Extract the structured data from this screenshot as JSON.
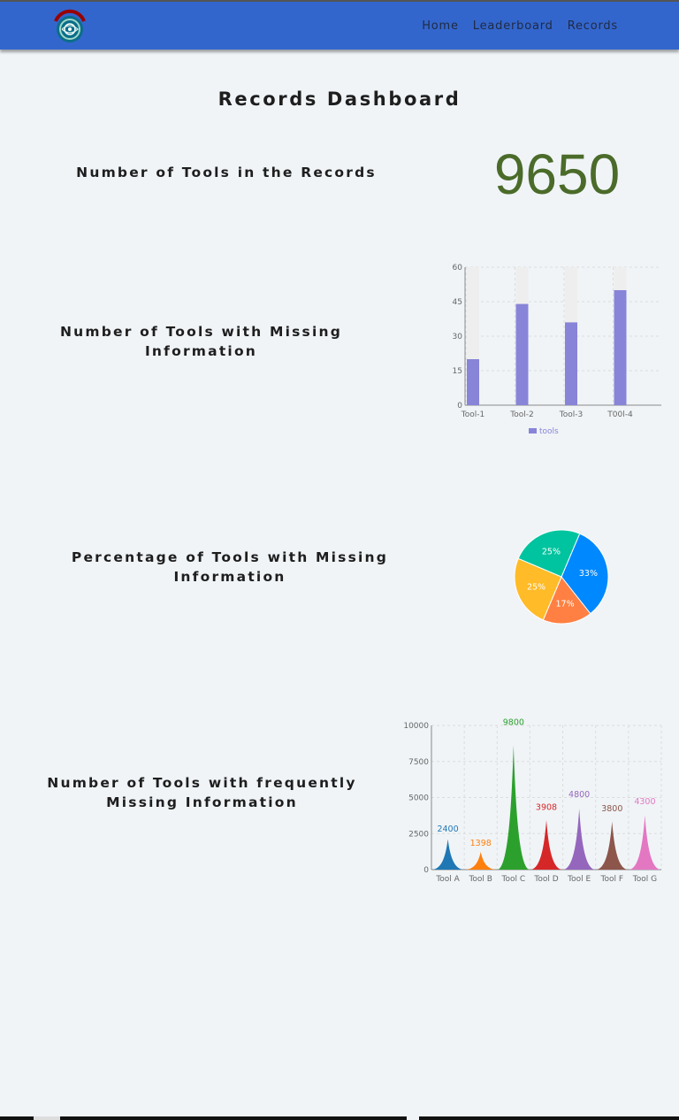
{
  "nav": {
    "links": [
      "Home",
      "Leaderboard",
      "Records"
    ]
  },
  "page": {
    "title": "Records Dashboard"
  },
  "sections": {
    "total": {
      "label": "Number of Tools in the Records",
      "value": "9650"
    },
    "missing": {
      "label_line1": "Number of Tools with Missing",
      "label_line2": "Information"
    },
    "percentage": {
      "label_line1": "Percentage of Tools with Missing",
      "label_line2": "Information"
    },
    "frequent": {
      "label_line1": "Number of Tools with frequently",
      "label_line2": "Missing Information"
    }
  },
  "colors": {
    "navbar": "#3366cc",
    "big_number": "#4b6b2a",
    "bar": "#8884d8",
    "bar_background": "#eeeeee"
  },
  "chart_data": [
    {
      "type": "bar",
      "categories": [
        "Tool-1",
        "Tool-2",
        "Tool-3",
        "T00l-4"
      ],
      "series": [
        {
          "name": "tools",
          "values": [
            20,
            44,
            36,
            50
          ]
        }
      ],
      "ylim": [
        0,
        60
      ],
      "yticks": [
        0,
        15,
        30,
        45,
        60
      ],
      "grid": true,
      "legend": "bottom"
    },
    {
      "type": "pie",
      "slices": [
        {
          "label": "33%",
          "value": 33,
          "color": "#0088fe"
        },
        {
          "label": "17%",
          "value": 17,
          "color": "#ff8042"
        },
        {
          "label": "25%",
          "value": 25,
          "color": "#ffbb28"
        },
        {
          "label": "25%",
          "value": 25,
          "color": "#00c49f"
        }
      ]
    },
    {
      "type": "bar",
      "shape": "spike",
      "categories": [
        "Tool A",
        "Tool B",
        "Tool C",
        "Tool D",
        "Tool E",
        "Tool F",
        "Tool G"
      ],
      "values": [
        2400,
        1398,
        9800,
        3908,
        4800,
        3800,
        4300
      ],
      "colors": [
        "#1f77b4",
        "#ff7f0e",
        "#2ca02c",
        "#d62728",
        "#9467bd",
        "#8c564b",
        "#e377c2"
      ],
      "ylim": [
        0,
        10000
      ],
      "yticks": [
        0,
        2500,
        5000,
        7500,
        10000
      ],
      "grid": true
    }
  ]
}
